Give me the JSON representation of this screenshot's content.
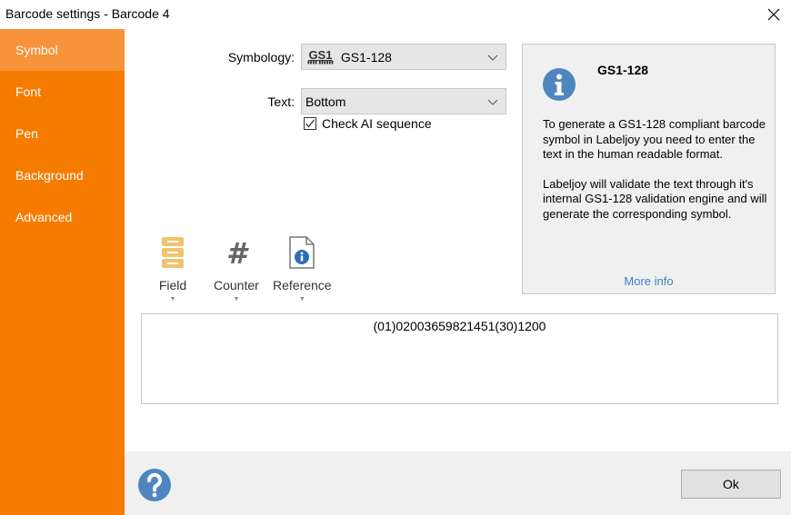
{
  "window": {
    "title": "Barcode settings - Barcode 4",
    "close_icon": "close-icon"
  },
  "sidebar": {
    "items": [
      {
        "label": "Symbol",
        "active": true
      },
      {
        "label": "Font",
        "active": false
      },
      {
        "label": "Pen",
        "active": false
      },
      {
        "label": "Background",
        "active": false
      },
      {
        "label": "Advanced",
        "active": false
      }
    ]
  },
  "form": {
    "symbology_label": "Symbology:",
    "symbology_logo_text": "GS1",
    "symbology_logo_bars": "▮▮▮▮ ▮▮▮▮▮▮",
    "symbology_value": "GS1-128",
    "text_label": "Text:",
    "text_value": "Bottom",
    "check_ai_label": "Check AI sequence",
    "check_ai_checked": true
  },
  "info_panel": {
    "icon": "info-icon",
    "title": "GS1-128",
    "paragraph1": "To generate a GS1-128 compliant barcode symbol in Labeljoy you need to enter the text in the human readable format.",
    "paragraph2": "Labeljoy will validate the text through it's internal GS1-128 validation engine and will generate the corresponding symbol.",
    "link": "More info",
    "link_color": "#3c7fc8"
  },
  "toolbar": {
    "buttons": [
      {
        "label": "Field",
        "icon": "database-field-icon",
        "arrow": "▼"
      },
      {
        "label": "Counter",
        "icon": "hash-counter-icon",
        "arrow": "▼"
      },
      {
        "label": "Reference",
        "icon": "document-info-icon",
        "arrow": "▼"
      }
    ]
  },
  "barcode_text": {
    "value": "(01)02003659821451(30)1200"
  },
  "footer": {
    "help_icon": "help-icon",
    "ok_label": "Ok"
  },
  "colors": {
    "sidebar": "#f57c00",
    "sidebar_active": "#f7933a",
    "info_icon": "#4f86c0"
  }
}
